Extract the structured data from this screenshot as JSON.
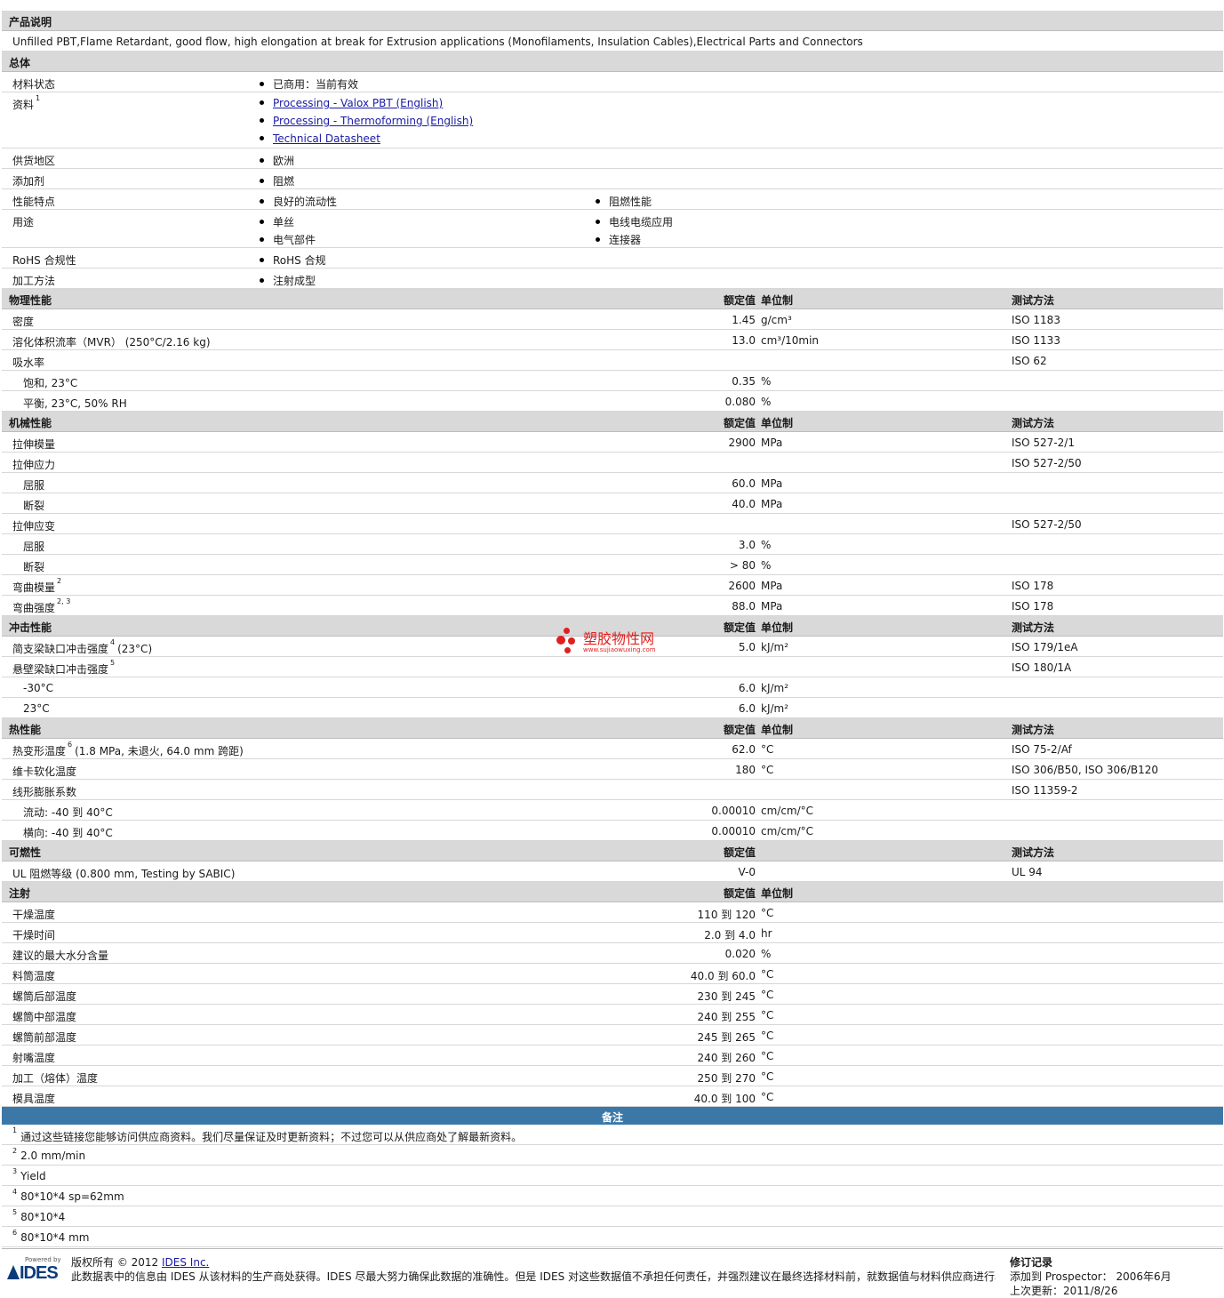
{
  "watermark": {
    "cn": "塑胶物性网",
    "url": "www.sujiaowuxing.com"
  },
  "desc": {
    "title": "产品说明",
    "text": "Unfilled PBT,Flame Retardant, good flow, high elongation at break for Extrusion applications (Monofilaments, Insulation Cables),Electrical Parts and Connectors"
  },
  "general": {
    "title": "总体",
    "rows": [
      {
        "label": "材料状态",
        "items": [
          "已商用：当前有效"
        ]
      },
      {
        "label": "资料",
        "sup": "1",
        "links": [
          "Processing - Valox PBT (English)",
          "Processing - Thermoforming (English)",
          "Technical Datasheet"
        ]
      },
      {
        "label": "供货地区",
        "items": [
          "欧洲"
        ]
      },
      {
        "label": "添加剂",
        "items": [
          "阻燃"
        ]
      },
      {
        "label": "性能特点",
        "items": [
          "良好的流动性",
          "阻燃性能"
        ]
      },
      {
        "label": "用途",
        "items": [
          "单丝",
          "电线电缆应用",
          "电气部件",
          "连接器"
        ]
      },
      {
        "label": "RoHS 合规性",
        "items": [
          "RoHS 合规"
        ]
      },
      {
        "label": "加工方法",
        "items": [
          "注射成型"
        ]
      }
    ]
  },
  "col": {
    "value": "额定值",
    "unit": "单位制",
    "method": "测试方法"
  },
  "physical": {
    "title": "物理性能",
    "rows": [
      {
        "label": "密度",
        "value": "1.45",
        "unit": "g/cm³",
        "method": "ISO 1183"
      },
      {
        "label": "溶化体积流率（MVR） (250°C/2.16 kg)",
        "value": "13.0",
        "unit": "cm³/10min",
        "method": "ISO 1133"
      },
      {
        "label": "吸水率",
        "method": "ISO 62"
      },
      {
        "label": "饱和, 23°C",
        "indent": true,
        "value": "0.35",
        "unit": "%"
      },
      {
        "label": "平衡, 23°C, 50% RH",
        "indent": true,
        "value": "0.080",
        "unit": "%"
      }
    ]
  },
  "mechanical": {
    "title": "机械性能",
    "rows": [
      {
        "label": "拉伸模量",
        "value": "2900",
        "unit": "MPa",
        "method": "ISO 527-2/1"
      },
      {
        "label": "拉伸应力",
        "method": "ISO 527-2/50"
      },
      {
        "label": "屈服",
        "indent": true,
        "value": "60.0",
        "unit": "MPa"
      },
      {
        "label": "断裂",
        "indent": true,
        "value": "40.0",
        "unit": "MPa"
      },
      {
        "label": "拉伸应变",
        "method": "ISO 527-2/50"
      },
      {
        "label": "屈服",
        "indent": true,
        "value": "3.0",
        "unit": "%"
      },
      {
        "label": "断裂",
        "indent": true,
        "value": "> 80",
        "unit": "%"
      },
      {
        "label": "弯曲模量",
        "sup": "2",
        "value": "2600",
        "unit": "MPa",
        "method": "ISO 178"
      },
      {
        "label": "弯曲强度",
        "sup": "2, 3",
        "value": "88.0",
        "unit": "MPa",
        "method": "ISO 178"
      }
    ]
  },
  "impact": {
    "title": "冲击性能",
    "rows": [
      {
        "label": "简支梁缺口冲击强度",
        "sup": "4",
        "suffix": "(23°C)",
        "value": "5.0",
        "unit": "kJ/m²",
        "method": "ISO 179/1eA"
      },
      {
        "label": "悬壁梁缺口冲击强度",
        "sup": "5",
        "method": "ISO 180/1A"
      },
      {
        "label": "-30°C",
        "indent": true,
        "value": "6.0",
        "unit": "kJ/m²"
      },
      {
        "label": "23°C",
        "indent": true,
        "value": "6.0",
        "unit": "kJ/m²"
      }
    ]
  },
  "thermal": {
    "title": "热性能",
    "rows": [
      {
        "label": "热变形温度",
        "sup": "6",
        "suffix": "(1.8 MPa, 未退火, 64.0 mm 跨距)",
        "value": "62.0",
        "unit": "°C",
        "method": "ISO 75-2/Af"
      },
      {
        "label": "维卡软化温度",
        "value": "180",
        "unit": "°C",
        "method": "ISO 306/B50, ISO 306/B120"
      },
      {
        "label": "线形膨胀系数",
        "method": "ISO 11359-2"
      },
      {
        "label": "流动: -40 到  40°C",
        "indent": true,
        "value": "0.00010",
        "unit": "cm/cm/°C"
      },
      {
        "label": "横向: -40 到  40°C",
        "indent": true,
        "value": "0.00010",
        "unit": "cm/cm/°C"
      }
    ]
  },
  "flammability": {
    "title": "可燃性",
    "rows": [
      {
        "label": "UL 阻燃等级 (0.800 mm, Testing by SABIC)",
        "value": "V-0",
        "method": "UL 94"
      }
    ]
  },
  "injection": {
    "title": "注射",
    "rows": [
      {
        "label": "干燥温度",
        "value": "110 到  120",
        "unit": "°C"
      },
      {
        "label": "干燥时间",
        "value": "2.0 到  4.0",
        "unit": "hr"
      },
      {
        "label": "建议的最大水分含量",
        "value": "0.020",
        "unit": "%"
      },
      {
        "label": "料筒温度",
        "value": "40.0 到  60.0",
        "unit": "°C"
      },
      {
        "label": "螺筒后部温度",
        "value": "230 到  245",
        "unit": "°C"
      },
      {
        "label": "螺筒中部温度",
        "value": "240 到  255",
        "unit": "°C"
      },
      {
        "label": "螺筒前部温度",
        "value": "245 到  265",
        "unit": "°C"
      },
      {
        "label": "射嘴温度",
        "value": "240 到  260",
        "unit": "°C"
      },
      {
        "label": "加工（熔体）温度",
        "value": "250 到  270",
        "unit": "°C"
      },
      {
        "label": "模具温度",
        "value": "40.0 到  100",
        "unit": "°C"
      }
    ]
  },
  "notes": {
    "title": "备注",
    "items": [
      {
        "n": "1",
        "text": "通过这些链接您能够访问供应商资料。我们尽量保证及时更新资料；不过您可以从供应商处了解最新资料。"
      },
      {
        "n": "2",
        "text": "2.0 mm/min"
      },
      {
        "n": "3",
        "text": "Yield"
      },
      {
        "n": "4",
        "text": "80*10*4 sp=62mm"
      },
      {
        "n": "5",
        "text": "80*10*4"
      },
      {
        "n": "6",
        "text": "80*10*4 mm"
      }
    ]
  },
  "footer": {
    "logo_small": "Powered by",
    "logo_name": "IDES",
    "copyright": "版权所有 © 2012",
    "company": "IDES Inc.",
    "disclaimer": "此数据表中的信息由 IDES 从该材料的生产商处获得。IDES 尽最大努力确保此数据的准确性。但是 IDES 对这些数据值不承担任何责任，并强烈建议在最终选择材料前，就数据值与材料供应商进行验证。",
    "rev_title": "修订记录",
    "rev_added": "添加到 Prospector： 2006年6月",
    "rev_updated": "上次更新：2011/8/26"
  }
}
